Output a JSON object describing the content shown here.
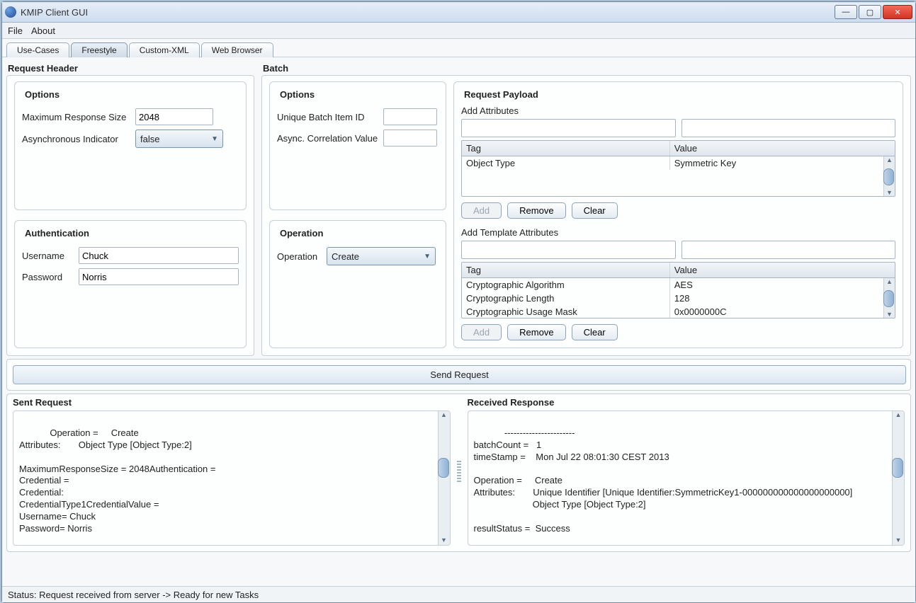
{
  "window": {
    "title": "KMIP Client GUI"
  },
  "menu": {
    "file": "File",
    "about": "About"
  },
  "tabs": {
    "usecases": "Use-Cases",
    "freestyle": "Freestyle",
    "customxml": "Custom-XML",
    "webbrowser": "Web Browser"
  },
  "requestHeader": {
    "title": "Request Header",
    "options": {
      "title": "Options",
      "maxRespLabel": "Maximum Response Size",
      "maxRespValue": "2048",
      "asyncLabel": "Asynchronous Indicator",
      "asyncValue": "false"
    },
    "auth": {
      "title": "Authentication",
      "usernameLabel": "Username",
      "usernameValue": "Chuck",
      "passwordLabel": "Password",
      "passwordValue": "Norris"
    }
  },
  "batch": {
    "title": "Batch",
    "options": {
      "title": "Options",
      "uniqueIdLabel": "Unique Batch Item ID",
      "uniqueIdValue": "",
      "asyncCorrLabel": "Async. Correlation Value",
      "asyncCorrValue": ""
    },
    "operation": {
      "title": "Operation",
      "label": "Operation",
      "value": "Create"
    },
    "payload": {
      "title": "Request Payload",
      "addAttributes": {
        "title": "Add Attributes",
        "headers": {
          "tag": "Tag",
          "value": "Value"
        },
        "rows": [
          {
            "tag": "Object Type",
            "value": "Symmetric Key"
          }
        ],
        "btnAdd": "Add",
        "btnRemove": "Remove",
        "btnClear": "Clear"
      },
      "addTemplateAttributes": {
        "title": "Add Template Attributes",
        "headers": {
          "tag": "Tag",
          "value": "Value"
        },
        "rows": [
          {
            "tag": "Cryptographic Algorithm",
            "value": "AES"
          },
          {
            "tag": "Cryptographic Length",
            "value": "128"
          },
          {
            "tag": "Cryptographic Usage Mask",
            "value": "0x0000000C"
          }
        ],
        "btnAdd": "Add",
        "btnRemove": "Remove",
        "btnClear": "Clear"
      }
    }
  },
  "sendRequest": "Send Request",
  "sentRequest": {
    "title": "Sent Request",
    "text": "Operation =     Create\nAttributes:       Object Type [Object Type:2]\n\nMaximumResponseSize = 2048Authentication =\nCredential =\nCredential:\nCredentialType1CredentialValue =\nUsername= Chuck\nPassword= Norris"
  },
  "receivedResponse": {
    "title": "Received Response",
    "text": "-----------------------\nbatchCount =   1\ntimeStamp =    Mon Jul 22 08:01:30 CEST 2013\n\nOperation =     Create\nAttributes:       Unique Identifier [Unique Identifier:SymmetricKey1-000000000000000000000]\n                       Object Type [Object Type:2]\n\nresultStatus =  Success"
  },
  "statusbar": "Status: Request received from server -> Ready for new Tasks"
}
